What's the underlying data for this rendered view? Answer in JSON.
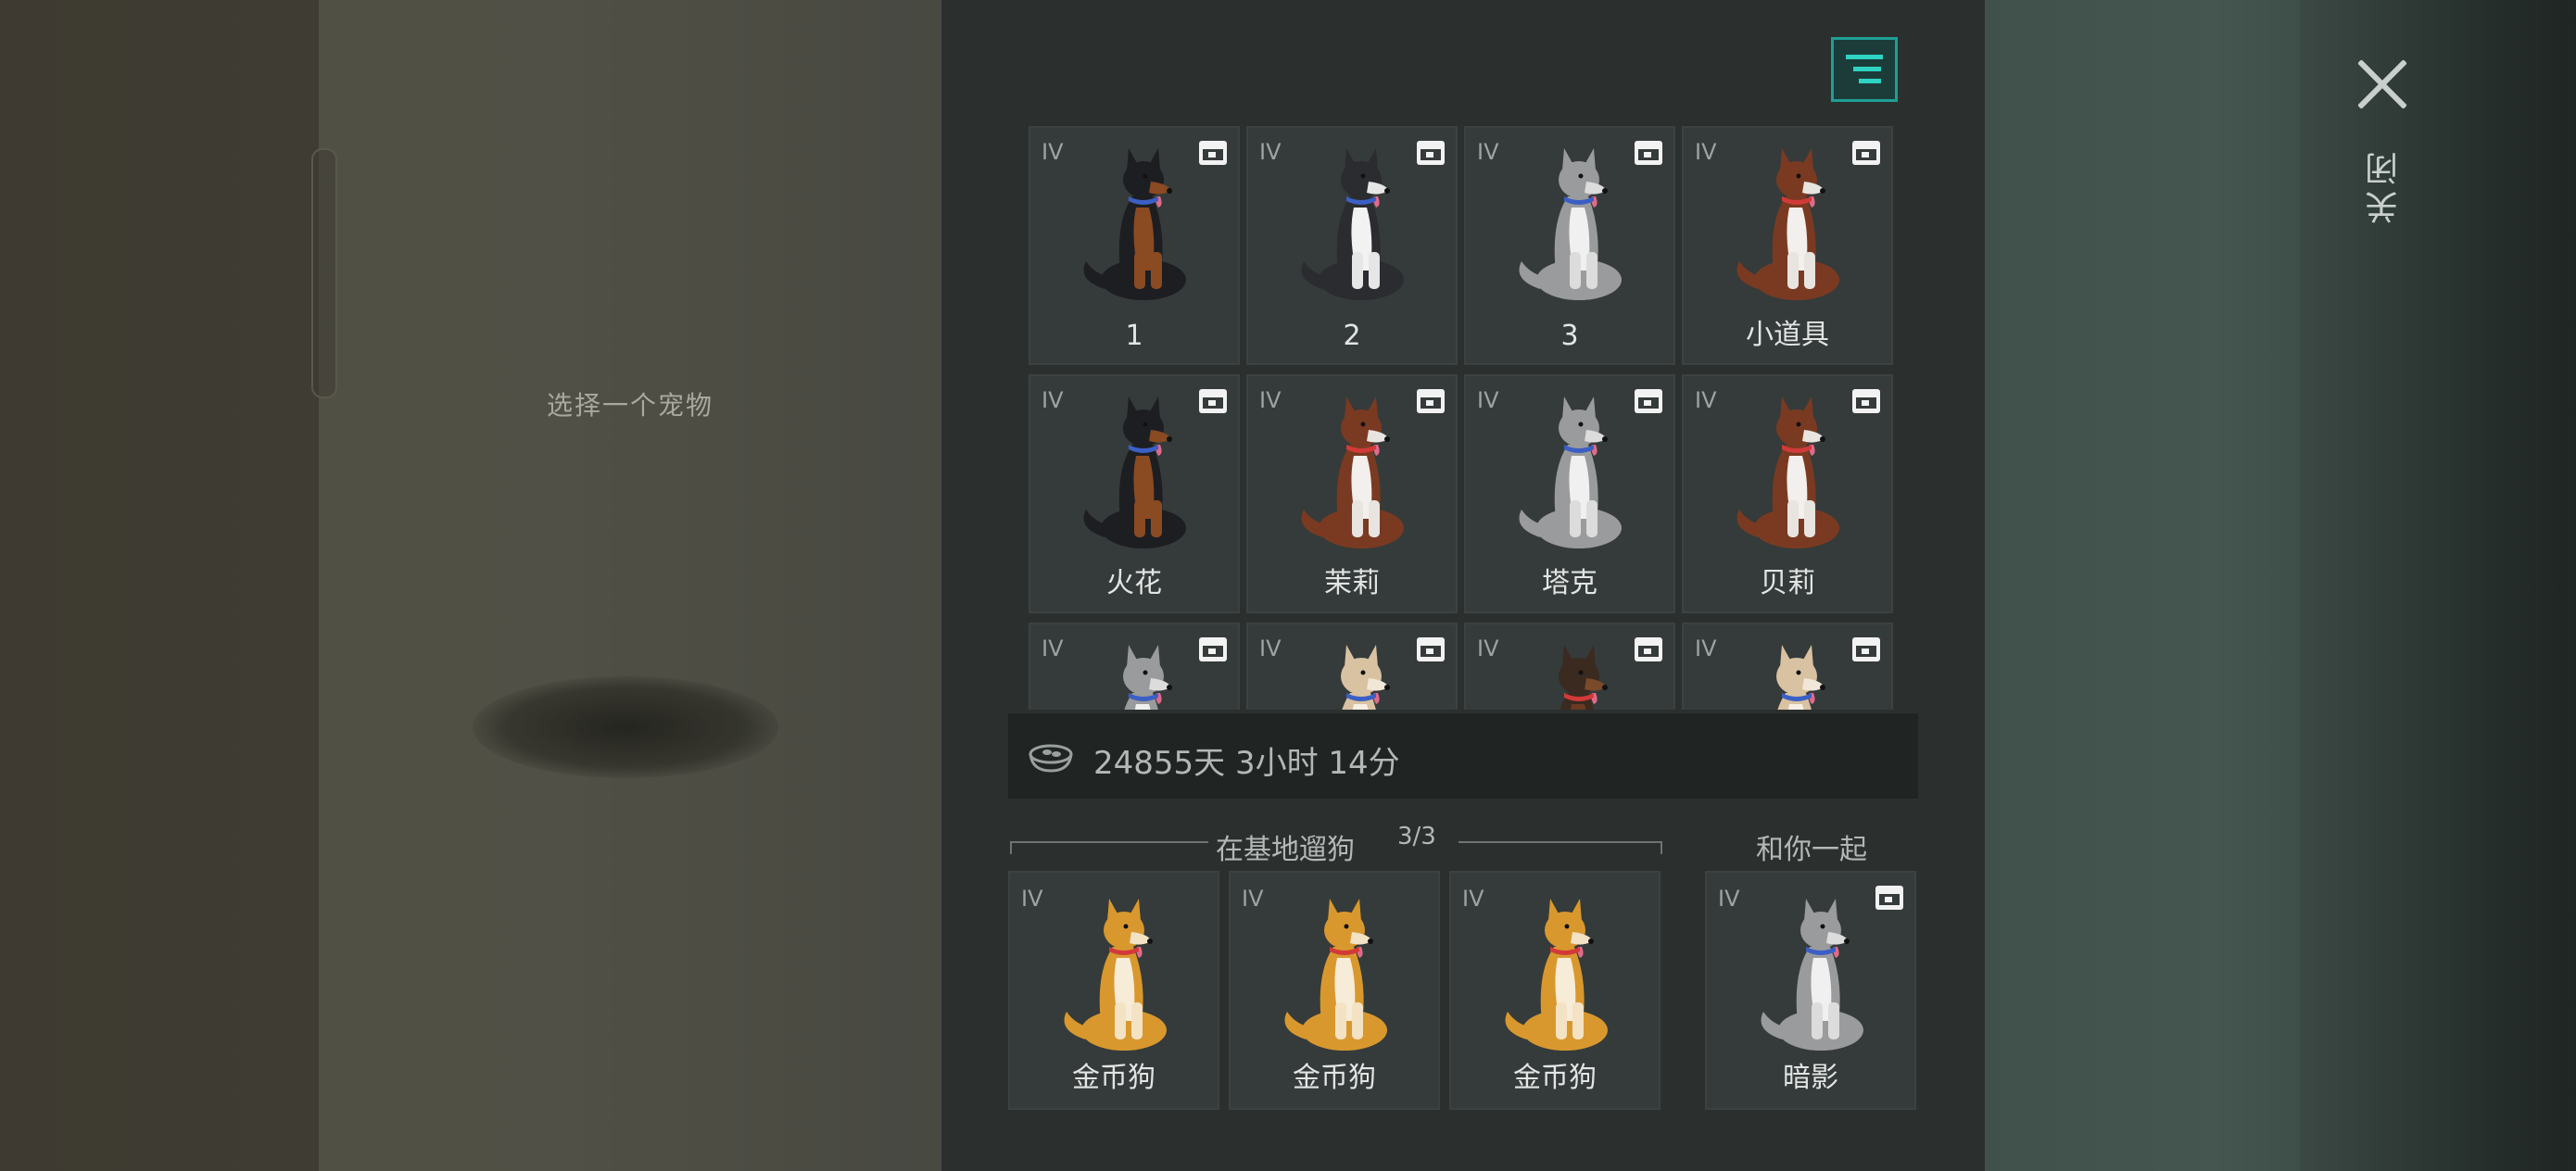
{
  "prompt": "选择一个宠物",
  "close_label": "关闭",
  "filter_icon": "filter-icon",
  "grid": [
    {
      "tier": "IV",
      "name": "1",
      "breed": "rottweiler"
    },
    {
      "tier": "IV",
      "name": "2",
      "breed": "husky-black"
    },
    {
      "tier": "IV",
      "name": "3",
      "breed": "husky-grey"
    },
    {
      "tier": "IV",
      "name": "小道具",
      "breed": "husky-red"
    },
    {
      "tier": "IV",
      "name": "火花",
      "breed": "rottweiler"
    },
    {
      "tier": "IV",
      "name": "茉莉",
      "breed": "husky-red"
    },
    {
      "tier": "IV",
      "name": "塔克",
      "breed": "husky-grey"
    },
    {
      "tier": "IV",
      "name": "贝莉",
      "breed": "husky-red"
    },
    {
      "tier": "IV",
      "name": "",
      "breed": "husky-grey"
    },
    {
      "tier": "IV",
      "name": "",
      "breed": "shiba-cream"
    },
    {
      "tier": "IV",
      "name": "",
      "breed": "shepherd-dark"
    },
    {
      "tier": "IV",
      "name": "",
      "breed": "shiba-cream"
    }
  ],
  "food": {
    "icon": "food-bowl-icon",
    "text": "24855天 3小时 14分"
  },
  "walk": {
    "title": "在基地遛狗",
    "count": "3/3"
  },
  "with_you_label": "和你一起",
  "walk_dogs": [
    {
      "tier": "IV",
      "name": "金币狗",
      "breed": "shiba"
    },
    {
      "tier": "IV",
      "name": "金币狗",
      "breed": "shiba"
    },
    {
      "tier": "IV",
      "name": "金币狗",
      "breed": "shiba"
    }
  ],
  "companion": {
    "tier": "IV",
    "name": "暗影",
    "breed": "husky-grey"
  },
  "colors": {
    "accent": "#1f9f94",
    "panel": "#2b302f",
    "card": "#353b3a"
  }
}
